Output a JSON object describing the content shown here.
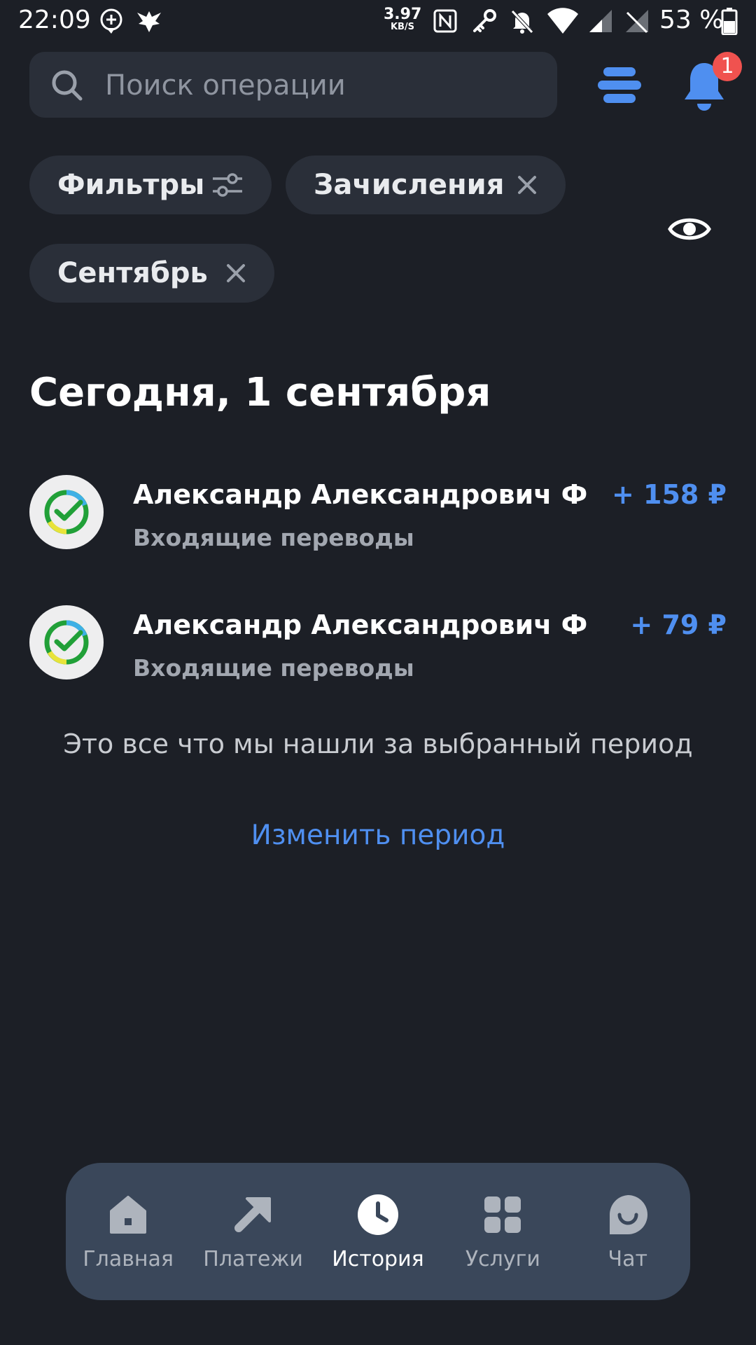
{
  "status_bar": {
    "time": "22:09",
    "speed_value": "3.97",
    "speed_unit": "KB/S",
    "battery": "53 %"
  },
  "search": {
    "placeholder": "Поиск операции"
  },
  "header_icons": {
    "notification_count": "1"
  },
  "filters": {
    "filters_label": "Фильтры",
    "chips": [
      {
        "label": "Зачисления"
      },
      {
        "label": "Сентябрь"
      }
    ]
  },
  "section": {
    "title": "Сегодня, 1 сентября"
  },
  "transactions": [
    {
      "name": "Александр Александрович Ф",
      "category": "Входящие переводы",
      "amount": "+ 158 ₽"
    },
    {
      "name": "Александр Александрович Ф",
      "category": "Входящие переводы",
      "amount": "+ 79 ₽"
    }
  ],
  "end_note": "Это все что мы нашли за выбранный период",
  "change_period": "Изменить период",
  "nav": {
    "items": [
      {
        "label": "Главная",
        "icon": "home-icon"
      },
      {
        "label": "Платежи",
        "icon": "arrow-icon"
      },
      {
        "label": "История",
        "icon": "clock-icon",
        "active": true
      },
      {
        "label": "Услуги",
        "icon": "grid-icon"
      },
      {
        "label": "Чат",
        "icon": "chat-icon"
      }
    ]
  },
  "colors": {
    "background": "#1c1f26",
    "surface": "#2a2f39",
    "accent": "#4f8ff0",
    "badge": "#f0524f",
    "nav_bg": "#3a475a"
  }
}
